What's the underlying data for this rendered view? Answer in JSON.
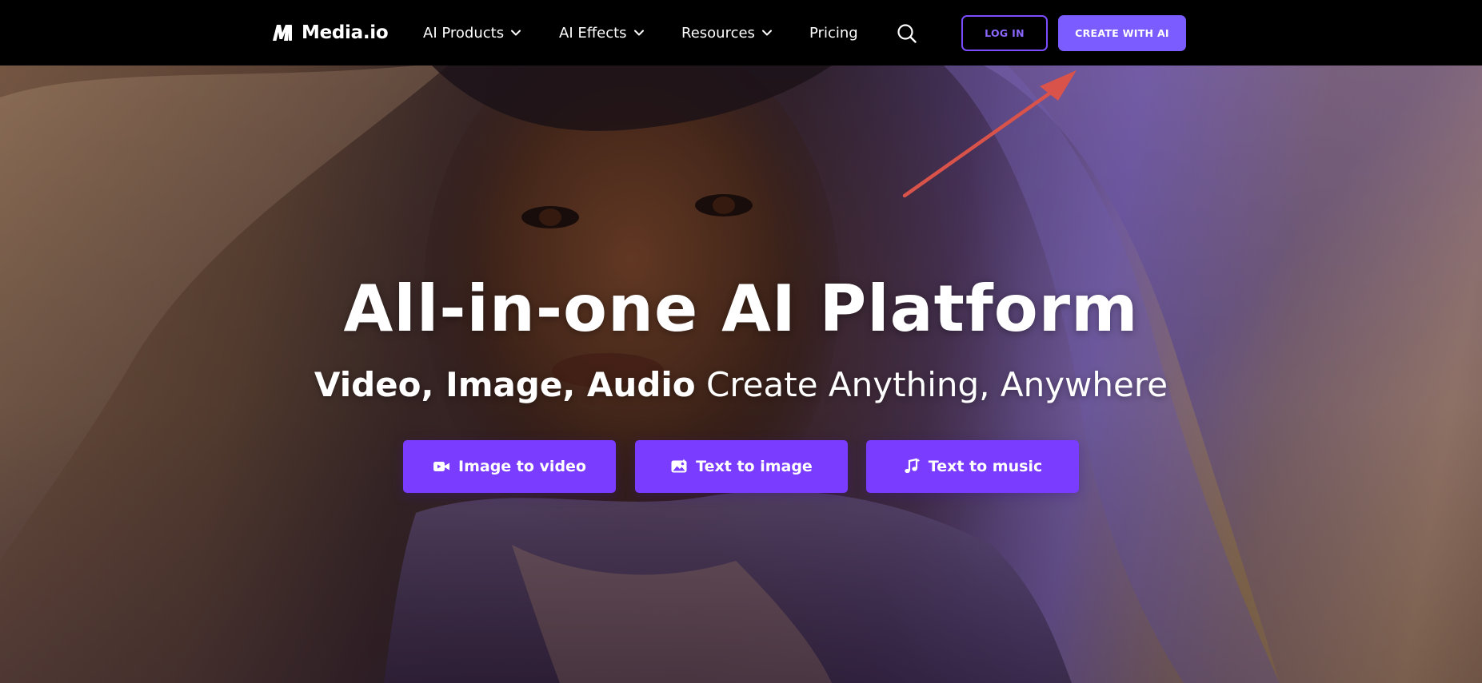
{
  "nav": {
    "logo_text": "Media.io",
    "items": [
      {
        "label": "AI Products",
        "icon": "chevron-down-icon"
      },
      {
        "label": "AI Effects",
        "icon": "chevron-down-icon"
      },
      {
        "label": "Resources",
        "icon": "chevron-down-icon"
      },
      {
        "label": "Pricing"
      }
    ],
    "search_icon": "search-icon",
    "login_label": "LOG IN",
    "create_label": "CREATE WITH AI"
  },
  "hero": {
    "title": "All-in-one AI Platform",
    "subtitle_bold": "Video, Image, Audio",
    "subtitle_rest": " Create Anything, Anywhere",
    "buttons": [
      {
        "label": "Image to video",
        "icon": "video-camera-icon"
      },
      {
        "label": "Text to image",
        "icon": "image-icon"
      },
      {
        "label": "Text to music",
        "icon": "music-note-icon"
      }
    ],
    "annotation_icon": "arrow-annotation-icon"
  },
  "colors": {
    "nav_bg": "#000000",
    "accent": "#7a3cff",
    "create_button": "#7b5cff",
    "login_border": "#7c4dff",
    "annotation_arrow": "#d9534a"
  }
}
